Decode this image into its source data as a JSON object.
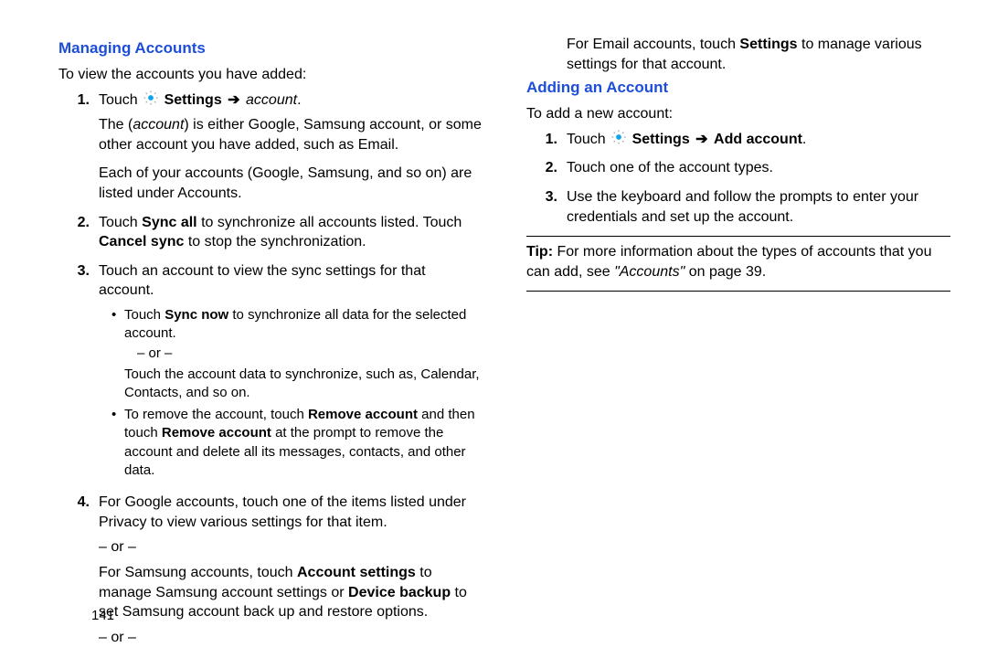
{
  "page_number": "141",
  "section1": {
    "heading": "Managing Accounts",
    "intro": "To view the accounts you have added:",
    "step1": {
      "num": "1.",
      "lead": "Touch ",
      "settings": "Settings",
      "account_word": "account",
      "desc1a": "The (",
      "desc1b": ") is either Google, Samsung account, or some other account you have added, such as Email.",
      "desc2": "Each of your accounts (Google, Samsung, and so on) are listed under Accounts."
    },
    "step2": {
      "num": "2.",
      "a": "Touch ",
      "syncall": "Sync all",
      "b": " to synchronize all accounts listed. Touch ",
      "cancel": "Cancel sync",
      "c": " to stop the synchronization."
    },
    "step3": {
      "num": "3.",
      "text": "Touch an account to view the sync settings for that account.",
      "b1a": "Touch ",
      "b1bold": "Sync now",
      "b1b": " to synchronize all data for the selected account.",
      "or": "– or –",
      "b1c": "Touch the account data to synchronize, such as, Calendar, Contacts, and so on.",
      "b2a": "To remove the account, touch ",
      "b2bold1": "Remove account",
      "b2b": " and then touch ",
      "b2bold2": "Remove account",
      "b2c": " at the prompt to remove the account and delete all its messages, contacts, and other data."
    },
    "step4": {
      "num": "4.",
      "p1": "For Google accounts, touch one of the items listed under Privacy to view various settings for that item.",
      "or": "– or –",
      "p2a": "For Samsung accounts, touch ",
      "p2bold1": "Account settings",
      "p2b": " to manage Samsung account settings or ",
      "p2bold2": "Device backup",
      "p2c": " to set Samsung account back up and restore options.",
      "p3a": "For Email accounts, touch ",
      "p3bold": "Settings",
      "p3b": " to manage various settings for that account."
    }
  },
  "section2": {
    "heading": "Adding an Account",
    "intro": "To add a new account:",
    "step1": {
      "num": "1.",
      "lead": "Touch ",
      "settings": "Settings",
      "add": "Add account"
    },
    "step2": {
      "num": "2.",
      "text": "Touch one of the account types."
    },
    "step3": {
      "num": "3.",
      "text": "Use the keyboard and follow the prompts to enter your credentials and set up the account."
    }
  },
  "tip": {
    "label": "Tip:",
    "a": " For more information about the types of accounts that you can add, see ",
    "ref": "\"Accounts\"",
    "b": " on page 39."
  }
}
